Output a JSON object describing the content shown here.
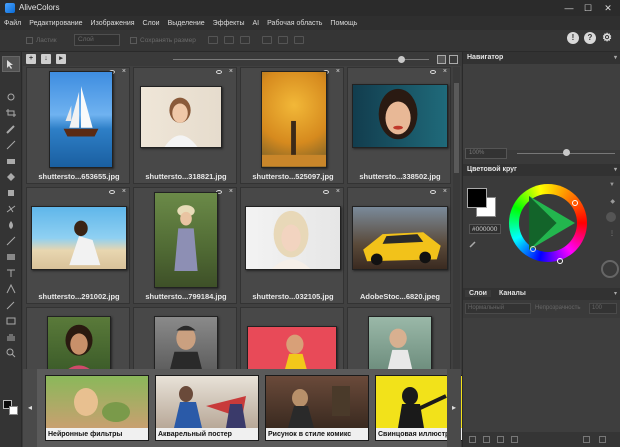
{
  "app": {
    "title": "AliveColors"
  },
  "window": {
    "minimize": "—",
    "maximize": "☐",
    "close": "✕"
  },
  "menu": [
    "Файл",
    "Редактирование",
    "Изображения",
    "Слои",
    "Выделение",
    "Эффекты",
    "AI",
    "Рабочая область",
    "Помощь"
  ],
  "options": {
    "feather_label": "Ластик",
    "layer_select": "Слой",
    "sample_label": "Сохранять размер",
    "alert_icon": "!",
    "help_icon": "?",
    "settings_icon": "⚙"
  },
  "browser": {
    "items": [
      {
        "caption": "shuttersto...653655.jpg"
      },
      {
        "caption": "shuttersto...318821.jpg"
      },
      {
        "caption": "shuttersto...525097.jpg"
      },
      {
        "caption": "shuttersto...338502.jpg"
      },
      {
        "caption": "shuttersto...291002.jpg"
      },
      {
        "caption": "shuttersto...799184.jpg"
      },
      {
        "caption": "shuttersto...032105.jpg"
      },
      {
        "caption": "AdobeStoc...6820.jpeg"
      },
      {
        "caption": ""
      },
      {
        "caption": ""
      },
      {
        "caption": ""
      },
      {
        "caption": ""
      }
    ],
    "zoom_level": 0.89
  },
  "effects": [
    {
      "label": "Нейронные фильтры"
    },
    {
      "label": "Акварельный постер"
    },
    {
      "label": "Рисунок в стиле комикс"
    },
    {
      "label": "Свинцовая иллюстр"
    }
  ],
  "navigator": {
    "title": "Навигатор",
    "zoom": "100%",
    "zoom_slider": 0.5
  },
  "color_wheel": {
    "title": "Цветовой круг",
    "hex": "#000000",
    "foreground": "#000000",
    "background": "#ffffff"
  },
  "layers": {
    "tabs": [
      "Слои",
      "Каналы"
    ],
    "blend_mode": "Нормальный",
    "opacity_label": "Непрозрачность",
    "opacity_value": "100"
  },
  "colors": {
    "accent": "#2196f3",
    "triangle": "#23b64e"
  }
}
